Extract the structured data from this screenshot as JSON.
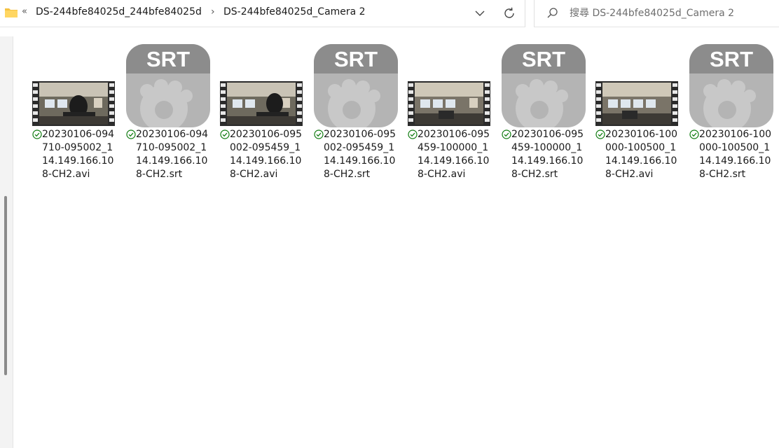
{
  "address": {
    "overflow": "«",
    "crumbs": [
      "DS-244bfe84025d_244bfe84025d",
      "DS-244bfe84025d_Camera 2"
    ],
    "separator": "›"
  },
  "search": {
    "placeholder": "搜尋 DS-244bfe84025d_Camera 2"
  },
  "srt_badge": "SRT",
  "files": [
    {
      "name": "20230106-094710-095002_114.149.166.108-CH2.avi",
      "type": "video"
    },
    {
      "name": "20230106-094710-095002_114.149.166.108-CH2.srt",
      "type": "srt"
    },
    {
      "name": "20230106-095002-095459_114.149.166.108-CH2.avi",
      "type": "video"
    },
    {
      "name": "20230106-095002-095459_114.149.166.108-CH2.srt",
      "type": "srt"
    },
    {
      "name": "20230106-095459-100000_114.149.166.108-CH2.avi",
      "type": "video"
    },
    {
      "name": "20230106-095459-100000_114.149.166.108-CH2.srt",
      "type": "srt"
    },
    {
      "name": "20230106-100000-100500_114.149.166.108-CH2.avi",
      "type": "video"
    },
    {
      "name": "20230106-100000-100500_114.149.166.108-CH2.srt",
      "type": "srt"
    }
  ],
  "colors": {
    "folder": "#f5c242",
    "sync_ok": "#107c10",
    "srt_icon_bg": "#b4b4b4",
    "srt_icon_band": "#8c8c8c"
  }
}
